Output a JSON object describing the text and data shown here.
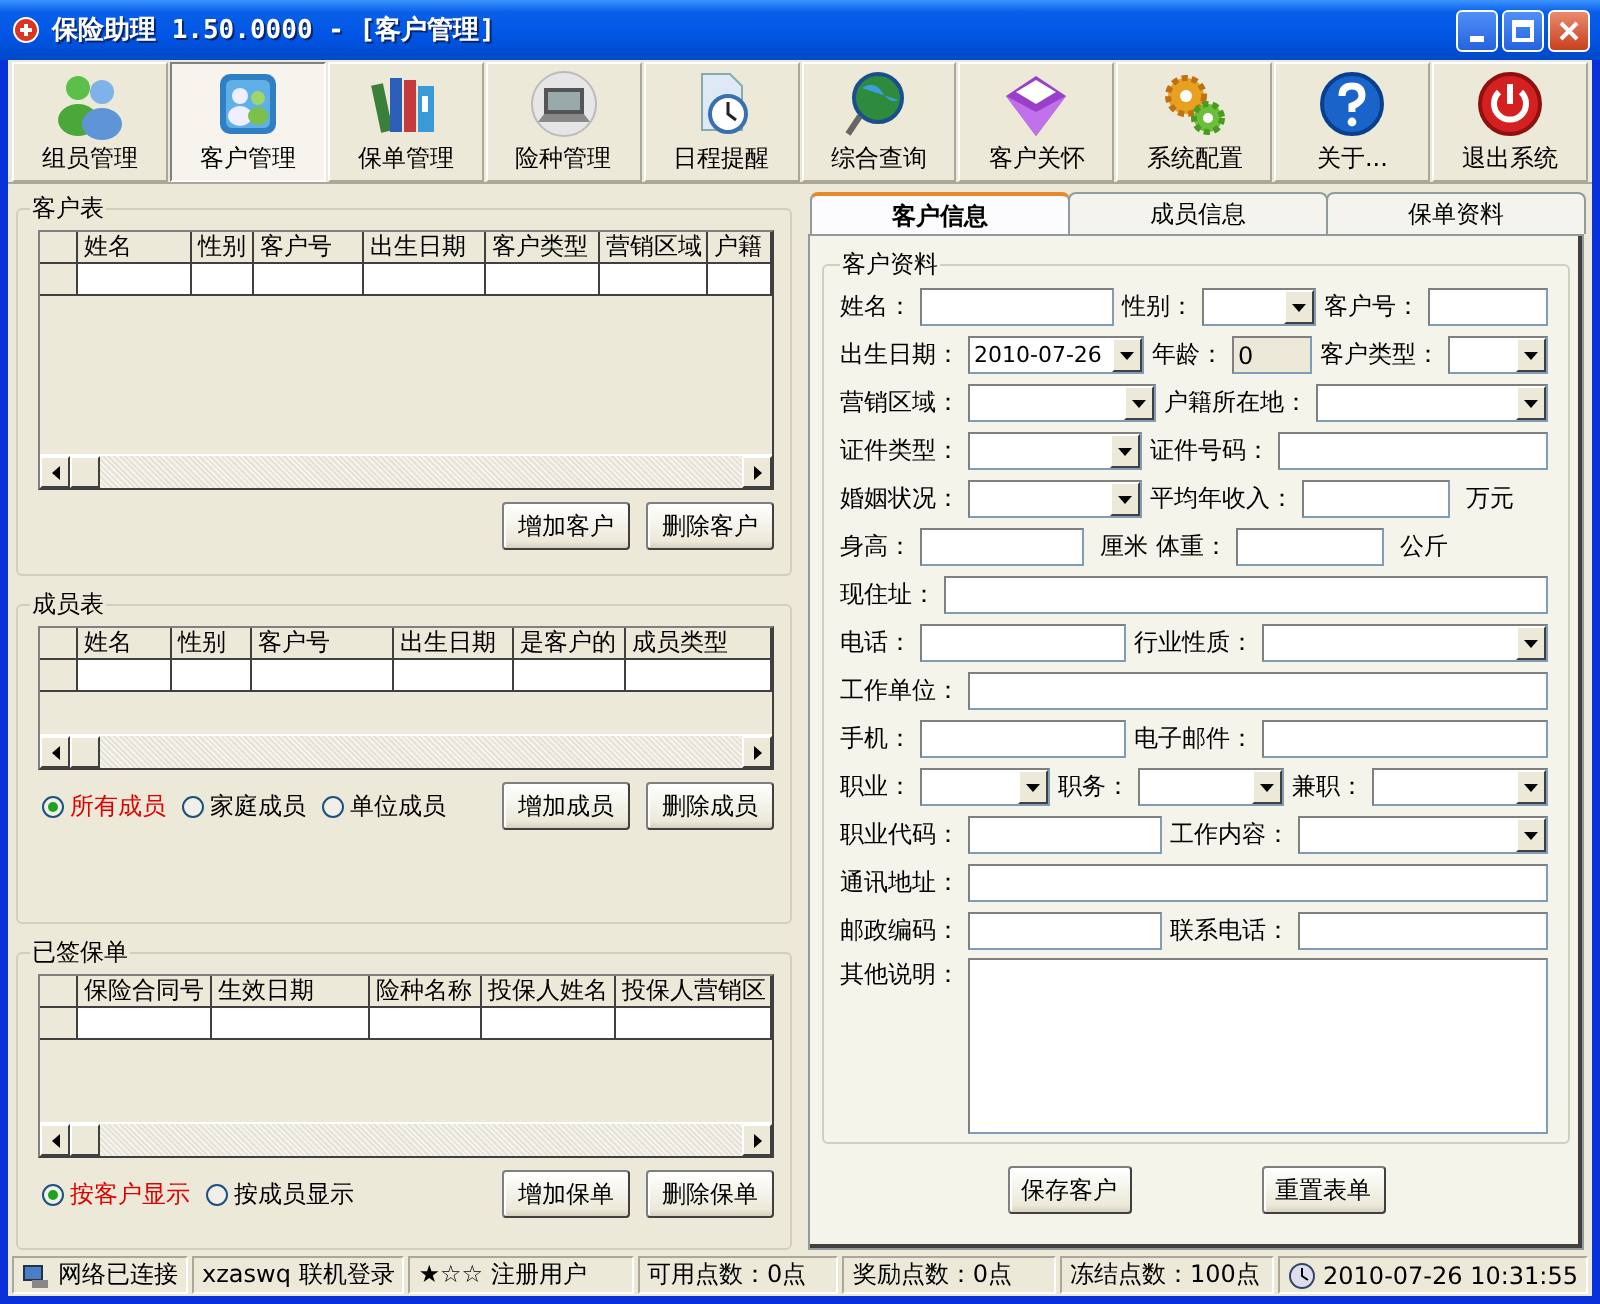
{
  "window": {
    "title": "保险助理 1.50.0000 - [客户管理]"
  },
  "toolbar": [
    {
      "label": "组员管理",
      "selected": false
    },
    {
      "label": "客户管理",
      "selected": true
    },
    {
      "label": "保单管理",
      "selected": false
    },
    {
      "label": "险种管理",
      "selected": false
    },
    {
      "label": "日程提醒",
      "selected": false
    },
    {
      "label": "综合查询",
      "selected": false
    },
    {
      "label": "客户关怀",
      "selected": false
    },
    {
      "label": "系统配置",
      "selected": false
    },
    {
      "label": "关于...",
      "selected": false
    },
    {
      "label": "退出系统",
      "selected": false
    }
  ],
  "customer_table": {
    "title": "客户表",
    "columns": [
      "姓名",
      "性别",
      "客户号",
      "出生日期",
      "客户类型",
      "营销区域",
      "户籍"
    ],
    "buttons": [
      "增加客户",
      "删除客户"
    ]
  },
  "member_table": {
    "title": "成员表",
    "columns": [
      "姓名",
      "性别",
      "客户号",
      "出生日期",
      "是客户的",
      "成员类型"
    ],
    "filters": [
      {
        "label": "所有成员",
        "selected": true
      },
      {
        "label": "家庭成员",
        "selected": false
      },
      {
        "label": "单位成员",
        "selected": false
      }
    ],
    "buttons": [
      "增加成员",
      "删除成员"
    ]
  },
  "policy_table": {
    "title": "已签保单",
    "columns": [
      "保险合同号",
      "生效日期",
      "险种名称",
      "投保人姓名",
      "投保人营销区"
    ],
    "filters": [
      {
        "label": "按客户显示",
        "selected": true
      },
      {
        "label": "按成员显示",
        "selected": false
      }
    ],
    "buttons": [
      "增加保单",
      "删除保单"
    ]
  },
  "tabs": [
    {
      "label": "客户信息",
      "selected": true
    },
    {
      "label": "成员信息",
      "selected": false
    },
    {
      "label": "保单资料",
      "selected": false
    }
  ],
  "form": {
    "title": "客户资料",
    "rows": [
      [
        {
          "label": "姓名：",
          "kind": "text"
        },
        {
          "label": "性别：",
          "kind": "combo"
        },
        {
          "label": "客户号：",
          "kind": "text"
        }
      ],
      [
        {
          "label": "出生日期：",
          "kind": "combo",
          "value": "2010-07-26"
        },
        {
          "label": "年龄：",
          "kind": "readonly",
          "value": "0"
        },
        {
          "label": "客户类型：",
          "kind": "combo"
        }
      ],
      [
        {
          "label": "营销区域：",
          "kind": "combo"
        },
        {
          "label": "户籍所在地：",
          "kind": "combo"
        }
      ],
      [
        {
          "label": "证件类型：",
          "kind": "combo"
        },
        {
          "label": "证件号码：",
          "kind": "text"
        }
      ],
      [
        {
          "label": "婚姻状况：",
          "kind": "combo"
        },
        {
          "label": "平均年收入：",
          "kind": "text",
          "unit": "万元"
        }
      ],
      [
        {
          "label": "身高：",
          "kind": "text",
          "unit": "厘米"
        },
        {
          "label": "体重：",
          "kind": "text",
          "unit": "公斤"
        }
      ],
      [
        {
          "label": "现住址：",
          "kind": "text"
        }
      ],
      [
        {
          "label": "电话：",
          "kind": "text"
        },
        {
          "label": "行业性质：",
          "kind": "combo"
        }
      ],
      [
        {
          "label": "工作单位：",
          "kind": "text"
        }
      ],
      [
        {
          "label": "手机：",
          "kind": "text"
        },
        {
          "label": "电子邮件：",
          "kind": "text"
        }
      ],
      [
        {
          "label": "职业：",
          "kind": "combo"
        },
        {
          "label": "职务：",
          "kind": "combo"
        },
        {
          "label": "兼职：",
          "kind": "combo"
        }
      ],
      [
        {
          "label": "职业代码：",
          "kind": "text"
        },
        {
          "label": "工作内容：",
          "kind": "combo"
        }
      ],
      [
        {
          "label": "通讯地址：",
          "kind": "text"
        }
      ],
      [
        {
          "label": "邮政编码：",
          "kind": "text"
        },
        {
          "label": "联系电话：",
          "kind": "text"
        }
      ],
      [
        {
          "label": "其他说明：",
          "kind": "memo"
        }
      ]
    ],
    "buttons": [
      "保存客户",
      "重置表单"
    ]
  },
  "status_bar": [
    "网络已连接",
    "xzaswq 联机登录",
    "★☆☆ 注册用户",
    "可用点数：0点",
    "奖励点数：0点",
    "冻结点数：100点",
    "2010-07-26 10:31:55"
  ]
}
